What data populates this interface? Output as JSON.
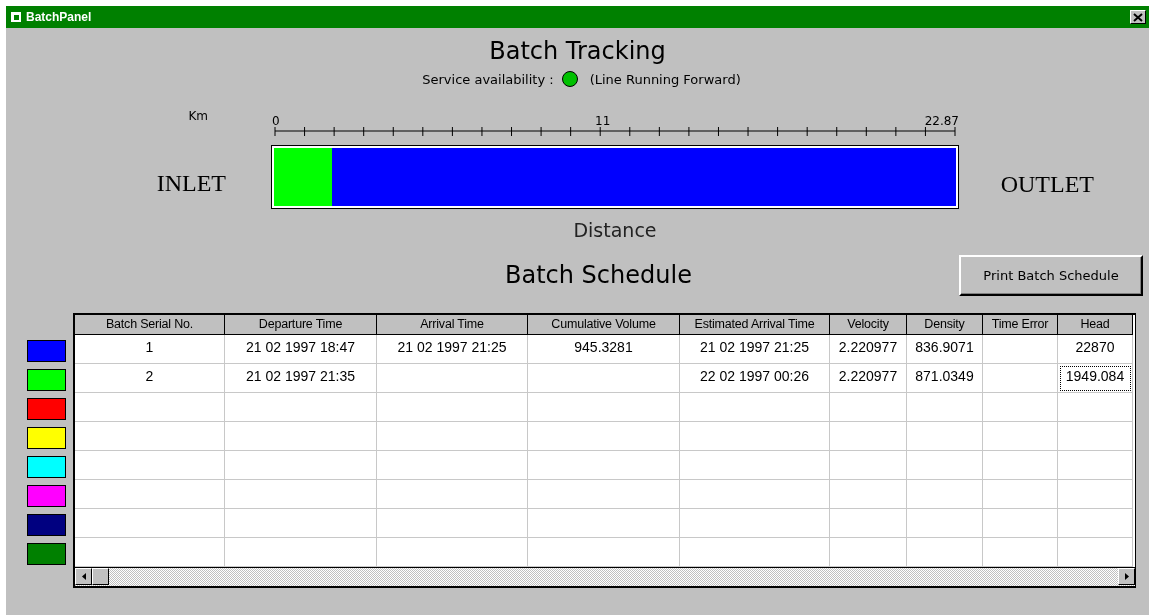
{
  "window": {
    "title": "BatchPanel"
  },
  "tracking": {
    "title": "Batch Tracking",
    "service": {
      "label": "Service availability :",
      "color": "#00c000",
      "status": "(Line Running Forward)"
    },
    "unit": "Km",
    "scale_labels": [
      "0",
      "11",
      "22.87"
    ],
    "inlet": "INLET",
    "outlet": "OUTLET",
    "axis_label": "Distance",
    "segments": [
      {
        "color": "#00ff00",
        "level": 0.085
      },
      {
        "color": "#0000ff",
        "level": 0.915
      }
    ]
  },
  "schedule": {
    "title": "Batch Schedule",
    "print_button": "Print Batch Schedule",
    "swatches": [
      {
        "color": "#0000ff"
      },
      {
        "color": "#00ff00"
      },
      {
        "color": "#ff0000"
      },
      {
        "color": "#ffff00"
      },
      {
        "color": "#00ffff"
      },
      {
        "color": "#ff00ff"
      },
      {
        "color": "#000080"
      },
      {
        "color": "#008000"
      }
    ],
    "columns": [
      "Batch Serial No.",
      "Departure Time",
      "Arrival Time",
      "Cumulative Volume",
      "Estimated Arrival Time",
      "Velocity",
      "Density",
      "Time Error",
      "Head"
    ],
    "rows": [
      {
        "cells": [
          "1",
          "21 02 1997  18:47",
          "21 02 1997  21:25",
          "945.3281",
          "21 02 1997  21:25",
          "2.220977",
          "836.9071",
          null,
          "22870"
        ],
        "focused": false
      },
      {
        "cells": [
          "2",
          "21 02 1997  21:35",
          null,
          null,
          "22 02 1997  00:26",
          "2.220977",
          "871.0349",
          null,
          "1949.084"
        ],
        "focused": true
      }
    ]
  }
}
